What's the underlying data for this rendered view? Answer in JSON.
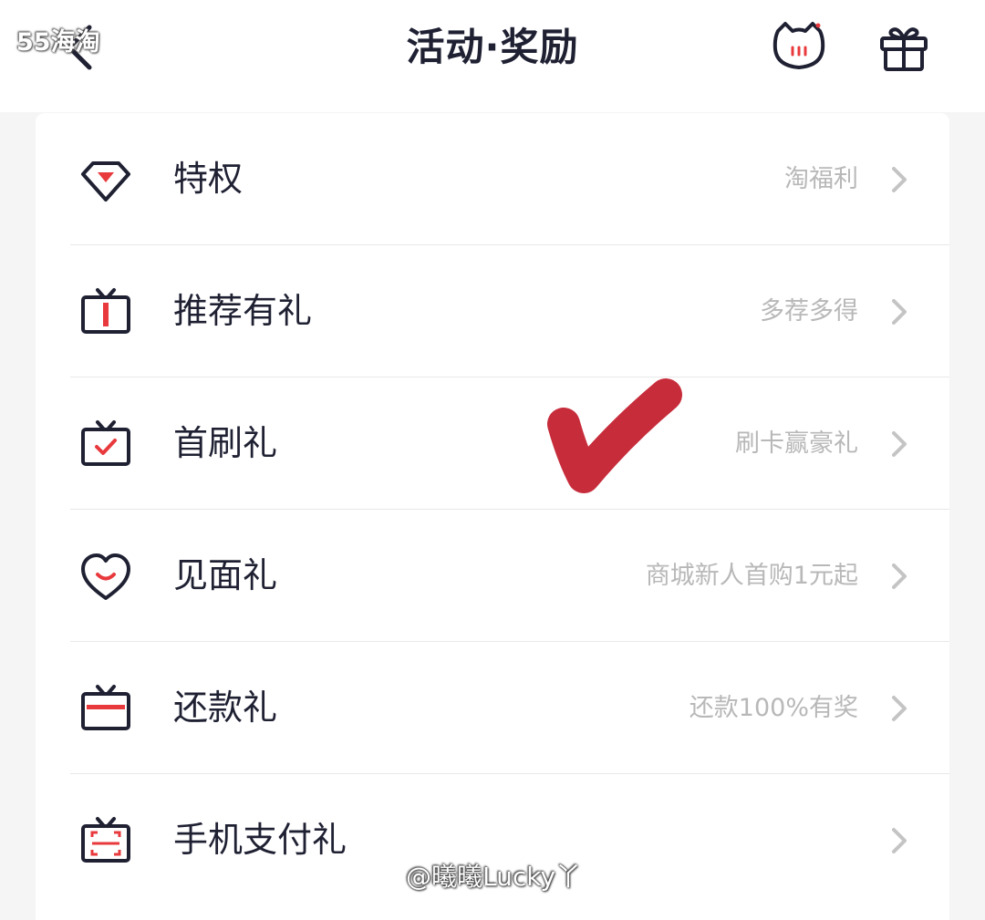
{
  "watermark_top": "55海淘",
  "header": {
    "title": "活动·奖励"
  },
  "rows": [
    {
      "title": "特权",
      "subtitle": "淘福利",
      "icon": "diamond-icon"
    },
    {
      "title": "推荐有礼",
      "subtitle": "多荐多得",
      "icon": "tv-gift-icon"
    },
    {
      "title": "首刷礼",
      "subtitle": "刷卡赢豪礼",
      "icon": "tv-check-icon"
    },
    {
      "title": "见面礼",
      "subtitle": "商城新人首购1元起",
      "icon": "heart-smile-icon"
    },
    {
      "title": "还款礼",
      "subtitle": "还款100%有奖",
      "icon": "tv-minus-icon"
    },
    {
      "title": "手机支付礼",
      "subtitle": "",
      "icon": "tv-scan-icon"
    }
  ],
  "colors": {
    "accent": "#e8393d",
    "dark": "#1f2133",
    "annotation": "#c21a2a"
  },
  "watermark_bottom": "@曦曦Lucky丫"
}
